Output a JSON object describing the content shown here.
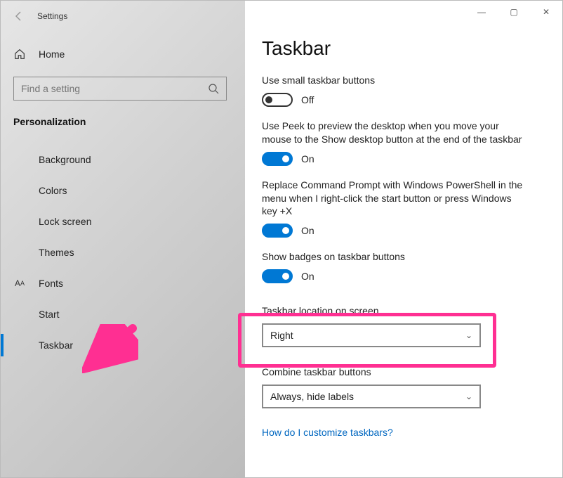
{
  "window": {
    "title": "Settings",
    "controls": {
      "min": "—",
      "max": "▢",
      "close": "✕"
    }
  },
  "sidebar": {
    "home": "Home",
    "search_placeholder": "Find a setting",
    "category": "Personalization",
    "items": [
      {
        "icon": "background",
        "label": "Background"
      },
      {
        "icon": "colors",
        "label": "Colors"
      },
      {
        "icon": "lockscreen",
        "label": "Lock screen"
      },
      {
        "icon": "themes",
        "label": "Themes"
      },
      {
        "icon": "fonts",
        "label": "Fonts"
      },
      {
        "icon": "start",
        "label": "Start"
      },
      {
        "icon": "taskbar",
        "label": "Taskbar"
      }
    ]
  },
  "page": {
    "title": "Taskbar",
    "settings": {
      "small_buttons": {
        "label": "Use small taskbar buttons",
        "value": "Off",
        "on": false
      },
      "peek": {
        "label": "Use Peek to preview the desktop when you move your mouse to the Show desktop button at the end of the taskbar",
        "value": "On",
        "on": true
      },
      "powershell": {
        "label": "Replace Command Prompt with Windows PowerShell in the menu when I right-click the start button or press Windows key +X",
        "value": "On",
        "on": true
      },
      "badges": {
        "label": "Show badges on taskbar buttons",
        "value": "On",
        "on": true
      },
      "location": {
        "label": "Taskbar location on screen",
        "value": "Right"
      },
      "combine": {
        "label": "Combine taskbar buttons",
        "value": "Always, hide labels"
      }
    },
    "link": "How do I customize taskbars?"
  },
  "annotation": {
    "highlight_target": "taskbar-location-setting",
    "arrow_target": "sidebar-item-taskbar",
    "color": "#ff2f92"
  }
}
